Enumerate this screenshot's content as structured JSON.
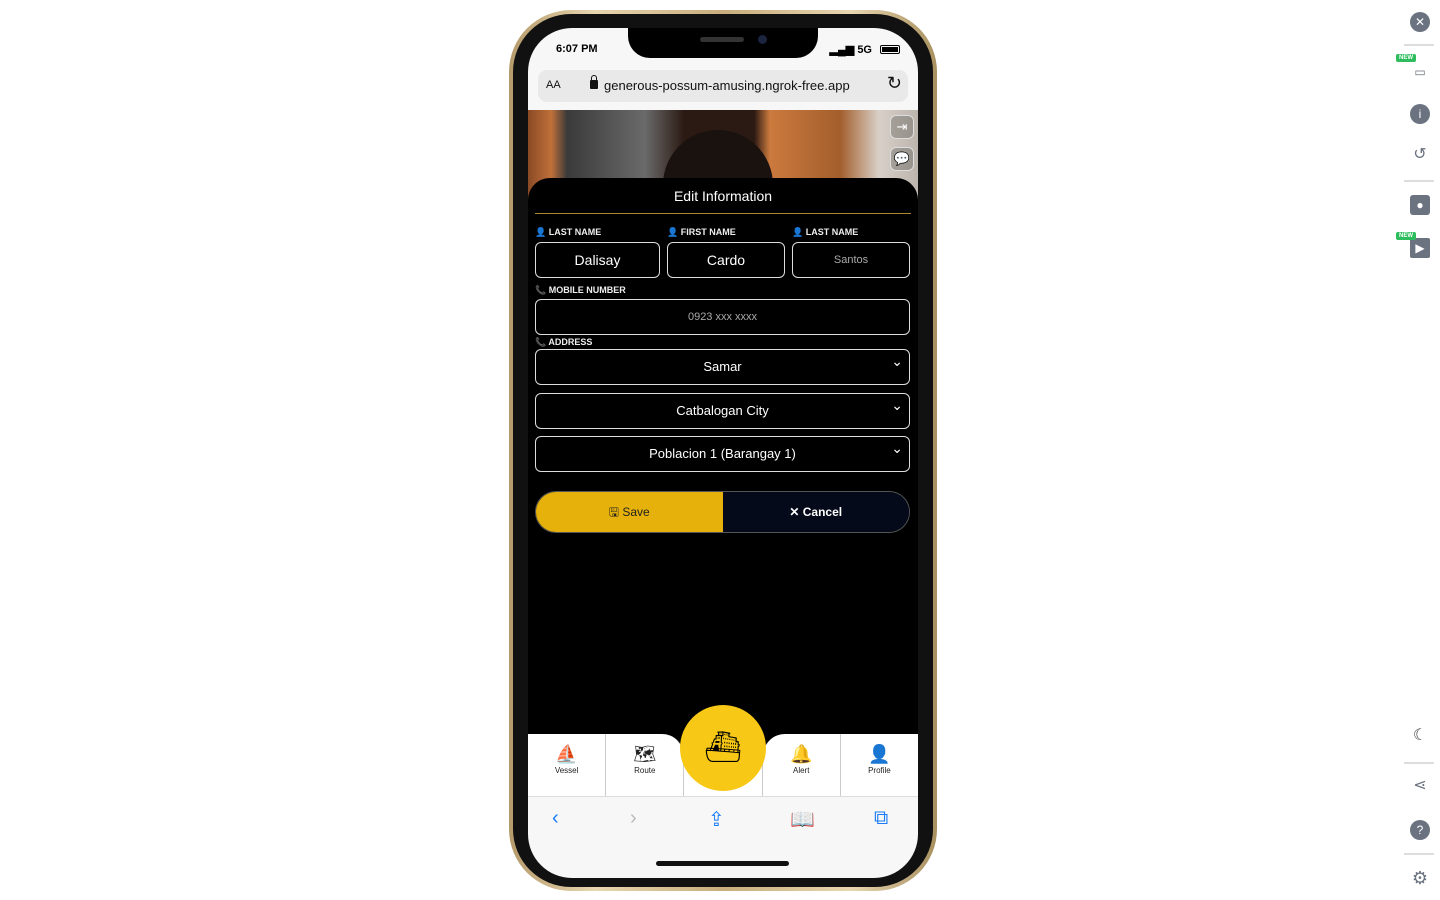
{
  "status": {
    "time": "6:07 PM",
    "network": "5G"
  },
  "browser": {
    "aa": "AA",
    "url": "generous-possum-amusing.ngrok-free.app"
  },
  "form": {
    "title": "Edit Information",
    "last_name_label": "LAST NAME",
    "last_name": "Dalisay",
    "first_name_label": "FIRST NAME",
    "first_name": "Cardo",
    "middle_name_label": "LAST NAME",
    "middle_name_placeholder": "Santos",
    "mobile_label": "MOBILE NUMBER",
    "mobile_placeholder": "0923 xxx xxxx",
    "address_label": "ADDRESS",
    "province": "Samar",
    "city": "Catbalogan City",
    "barangay": "Poblacion 1 (Barangay 1)",
    "save": "Save",
    "cancel": "Cancel"
  },
  "nav": {
    "items": [
      {
        "label": "Vessel"
      },
      {
        "label": "Route"
      },
      {
        "label": "Alert"
      },
      {
        "label": "Profile"
      }
    ]
  },
  "colors": {
    "accent": "#f7c815",
    "save": "#e6b10a",
    "cancel": "#050a1a"
  },
  "tools": {
    "new_badge": "NEW"
  }
}
